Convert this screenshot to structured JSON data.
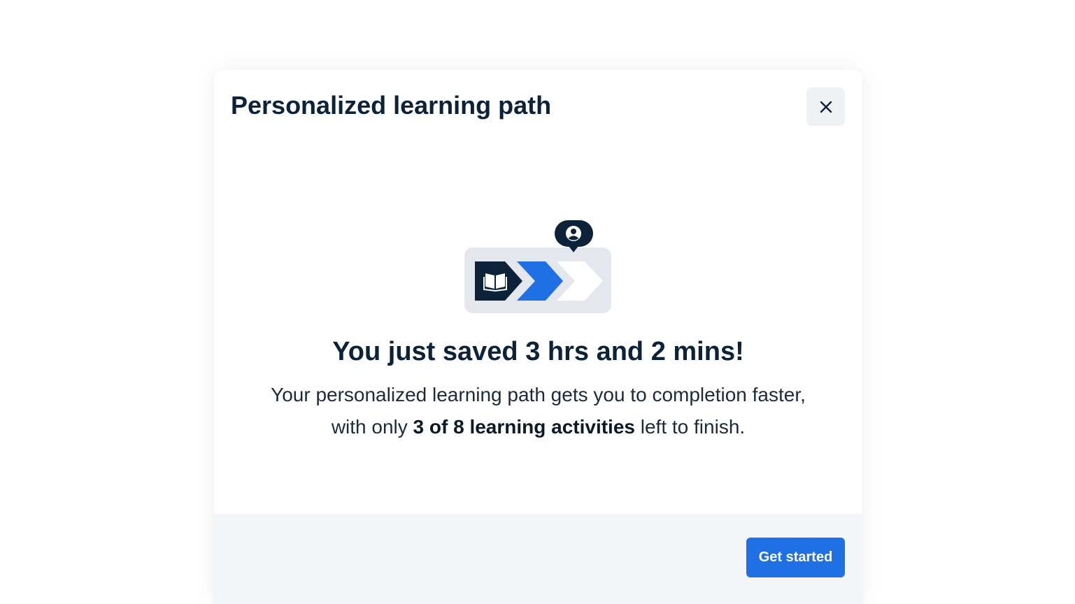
{
  "modal": {
    "title": "Personalized learning path",
    "close_label": "close"
  },
  "illustration": {
    "icons": [
      "book-icon",
      "progress-chevron-icon",
      "user-pin-icon"
    ],
    "colors": {
      "navy": "#0b2239",
      "blue": "#1f6fe5",
      "panel": "#e4e8ee",
      "white": "#ffffff"
    }
  },
  "content": {
    "headline": "You just saved 3 hrs and 2 mins!",
    "description_line1": "Your personalized learning path gets you to completion faster,",
    "description_prefix": "with only ",
    "description_bold": "3 of 8 learning activities",
    "description_suffix": " left to finish."
  },
  "footer": {
    "cta_label": "Get started"
  },
  "colors": {
    "accent": "#1f6fe5",
    "heading": "#0b2239",
    "footer_bg": "#f3f5f7"
  }
}
